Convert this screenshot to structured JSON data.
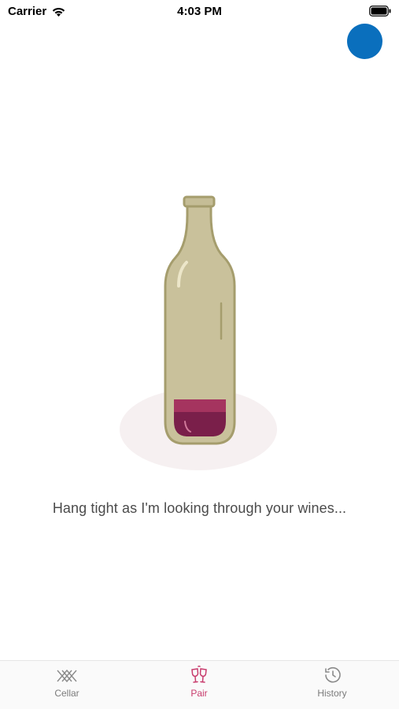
{
  "status_bar": {
    "carrier": "Carrier",
    "time": "4:03 PM",
    "icons": [
      "wifi-icon",
      "battery-icon"
    ]
  },
  "avatar": {
    "color": "#0a6fbd"
  },
  "loading": {
    "message": "Hang tight as I'm looking through your wines..."
  },
  "tab_bar": {
    "active_color": "#c83c6d",
    "inactive_color": "#7b7b7b",
    "tabs": [
      {
        "label": "Cellar",
        "icon": "cellar-icon",
        "active": false
      },
      {
        "label": "Pair",
        "icon": "glasses-icon",
        "active": true
      },
      {
        "label": "History",
        "icon": "history-icon",
        "active": false
      }
    ]
  }
}
